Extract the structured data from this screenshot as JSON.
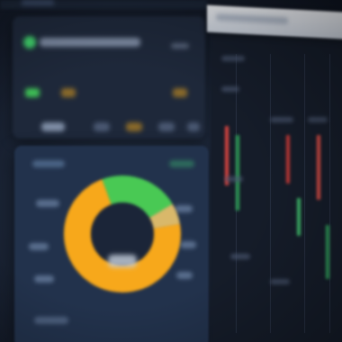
{
  "colors": {
    "background": "#1a2233",
    "card": "#1e283a",
    "donut_card": "#22324c",
    "accent_green": "#3fcf6a",
    "accent_orange": "#f7a81b",
    "accent_red": "#e0463f",
    "header_light": "#eef1f6"
  },
  "icons": [
    "status-dot-icon",
    "chart-icon",
    "calendar-icon"
  ],
  "donut": {
    "segments": [
      {
        "color": "#f7a81b",
        "fraction": 0.72
      },
      {
        "color": "#49c954",
        "fraction": 0.22
      },
      {
        "color": "#d9b86a",
        "fraction": 0.06
      }
    ],
    "track_color": "#1a2438",
    "center_color": "#1b2538"
  },
  "candles": [
    {
      "color": "#d94540",
      "value": 0.55
    },
    {
      "color": "#2d9b56",
      "value": 0.7
    },
    {
      "color": "#c43a37",
      "value": 0.45
    },
    {
      "color": "#3fb86a",
      "value": 0.35
    },
    {
      "color": "#d44b44",
      "value": 0.6
    },
    {
      "color": "#2f9a59",
      "value": 0.5
    }
  ]
}
